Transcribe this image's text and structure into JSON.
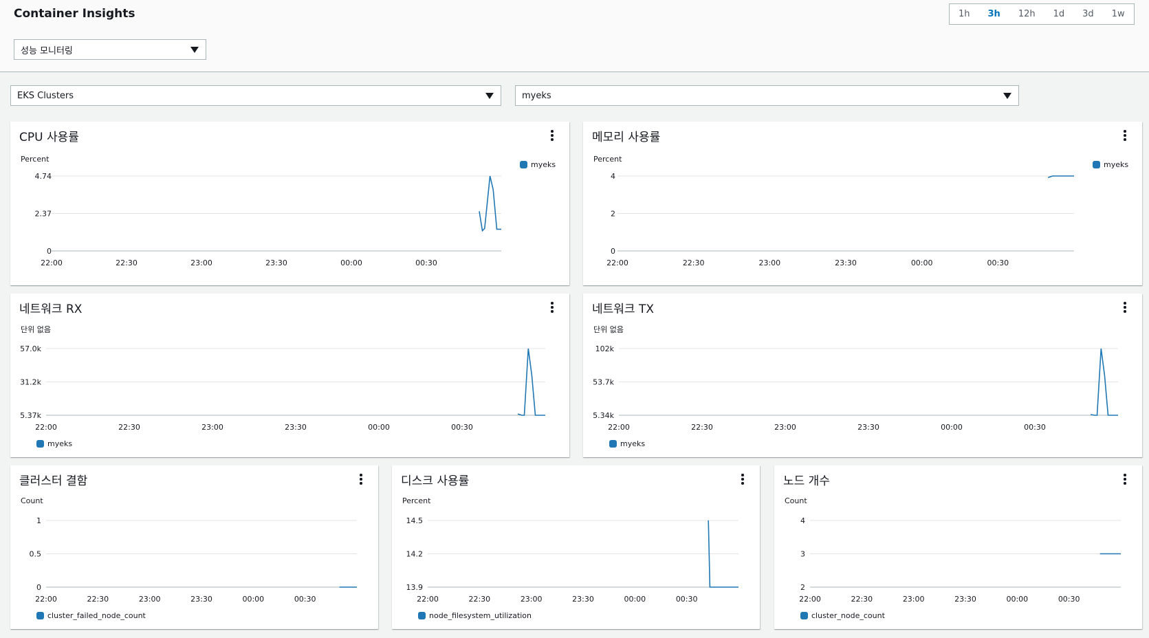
{
  "app": {
    "title": "Container Insights"
  },
  "time_range": {
    "options": [
      "1h",
      "3h",
      "12h",
      "1d",
      "3d",
      "1w"
    ],
    "selected": "3h"
  },
  "view_select": {
    "value": "성능 모니터링"
  },
  "resource_type_select": {
    "value": "EKS Clusters"
  },
  "cluster_select": {
    "value": "myeks"
  },
  "colors": {
    "series": "#1f77b4",
    "accent": "#0073bb",
    "grid": "#e3e3e3"
  },
  "panels": [
    {
      "title": "CPU 사용률",
      "unit": "Percent",
      "legend": "myeks",
      "legend_position": "right",
      "chart_data": {
        "type": "line",
        "y_ticks": [
          "4.74",
          "2.37",
          "0"
        ],
        "x_ticks": [
          "22:00",
          "22:30",
          "23:00",
          "23:30",
          "00:00",
          "00:30"
        ]
      }
    },
    {
      "title": "메모리 사용률",
      "unit": "Percent",
      "legend": "myeks",
      "legend_position": "right",
      "chart_data": {
        "type": "line",
        "y_ticks": [
          "4",
          "2",
          "0"
        ],
        "x_ticks": [
          "22:00",
          "22:30",
          "23:00",
          "23:30",
          "00:00",
          "00:30"
        ]
      }
    },
    {
      "title": "네트워크 RX",
      "unit": "단위 없음",
      "legend": "myeks",
      "legend_position": "bottom",
      "chart_data": {
        "type": "line",
        "y_ticks": [
          "57.0k",
          "31.2k",
          "5.37k"
        ],
        "x_ticks": [
          "22:00",
          "22:30",
          "23:00",
          "23:30",
          "00:00",
          "00:30"
        ]
      }
    },
    {
      "title": "네트워크 TX",
      "unit": "단위 없음",
      "legend": "myeks",
      "legend_position": "bottom",
      "chart_data": {
        "type": "line",
        "y_ticks": [
          "102k",
          "53.7k",
          "5.34k"
        ],
        "x_ticks": [
          "22:00",
          "22:30",
          "23:00",
          "23:30",
          "00:00",
          "00:30"
        ]
      }
    },
    {
      "title": "클러스터 결함",
      "unit": "Count",
      "legend": "cluster_failed_node_count",
      "legend_position": "bottom",
      "chart_data": {
        "type": "line",
        "y_ticks": [
          "1",
          "0.5",
          "0"
        ],
        "x_ticks": [
          "22:00",
          "22:30",
          "23:00",
          "23:30",
          "00:00",
          "00:30"
        ]
      }
    },
    {
      "title": "디스크 사용률",
      "unit": "Percent",
      "legend": "node_filesystem_utilization",
      "legend_position": "bottom",
      "chart_data": {
        "type": "line",
        "y_ticks": [
          "14.5",
          "14.2",
          "13.9"
        ],
        "x_ticks": [
          "22:00",
          "22:30",
          "23:00",
          "23:30",
          "00:00",
          "00:30"
        ]
      }
    },
    {
      "title": "노드 개수",
      "unit": "Count",
      "legend": "cluster_node_count",
      "legend_position": "bottom",
      "chart_data": {
        "type": "line",
        "y_ticks": [
          "4",
          "3",
          "2"
        ],
        "x_ticks": [
          "22:00",
          "22:30",
          "23:00",
          "23:30",
          "00:00",
          "00:30"
        ]
      }
    }
  ]
}
